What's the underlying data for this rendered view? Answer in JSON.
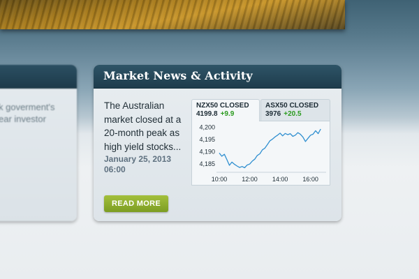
{
  "left_card": {
    "snippet_lines": [
      "k goverment's",
      "ear investor"
    ]
  },
  "news_card": {
    "title": "Market News & Activity",
    "article": {
      "text": "The Australian market closed at a 20-month peak as high yield stocks...",
      "date_line1": "January 25, 2013",
      "date_line2": "06:00"
    },
    "read_more_label": "READ MORE"
  },
  "chart_tabs": [
    {
      "name": "NZX50 CLOSED",
      "value": "4199.8",
      "change": "+9.9",
      "active": true
    },
    {
      "name": "ASX50 CLOSED",
      "value": "3976",
      "change": "+20.5",
      "active": false
    }
  ],
  "colors": {
    "header": "#1e3c4c",
    "accent_green": "#8caf2c",
    "change_green": "#2a9a1e",
    "line": "#2f8fd0"
  },
  "chart_data": {
    "type": "line",
    "title": "",
    "xlabel": "",
    "ylabel": "",
    "x_ticks": [
      "10:00",
      "12:00",
      "14:00",
      "16:00"
    ],
    "y_ticks": [
      4185,
      4190,
      4195,
      4200
    ],
    "xlim": [
      "10:00",
      "16:45"
    ],
    "ylim": [
      4182.5,
      4201
    ],
    "grid": false,
    "series": [
      {
        "x": [
          "10:00",
          "10:10",
          "10:20",
          "10:30",
          "10:40",
          "10:50",
          "11:00",
          "11:10",
          "11:20",
          "11:30",
          "11:40",
          "11:50",
          "12:00",
          "12:10",
          "12:20",
          "12:30",
          "12:40",
          "12:50",
          "13:00",
          "13:10",
          "13:20",
          "13:30",
          "13:40",
          "13:50",
          "14:00",
          "14:10",
          "14:20",
          "14:30",
          "14:40",
          "14:50",
          "15:00",
          "15:10",
          "15:20",
          "15:30",
          "15:40",
          "15:50",
          "16:00",
          "16:10",
          "16:20",
          "16:30",
          "16:40"
        ],
        "values": [
          4189.5,
          4188.2,
          4189.0,
          4186.8,
          4184.5,
          4185.8,
          4184.9,
          4184.2,
          4183.6,
          4184.0,
          4183.5,
          4184.6,
          4185.0,
          4186.2,
          4187.0,
          4188.5,
          4189.2,
          4190.8,
          4191.5,
          4193.0,
          4194.5,
          4195.2,
          4196.1,
          4196.8,
          4197.6,
          4196.5,
          4197.5,
          4197.0,
          4197.4,
          4196.3,
          4196.8,
          4197.8,
          4197.2,
          4196.0,
          4194.2,
          4195.5,
          4196.8,
          4197.2,
          4198.6,
          4197.4,
          4199.3
        ]
      }
    ]
  }
}
